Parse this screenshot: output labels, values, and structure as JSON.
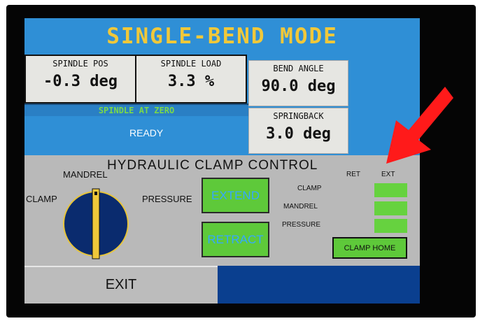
{
  "screen": {
    "title": "SINGLE-BEND MODE",
    "spindle_pos": {
      "label": "SPINDLE POS",
      "value": "-0.3 deg"
    },
    "spindle_load": {
      "label": "SPINDLE LOAD",
      "value": "3.3 %"
    },
    "bend_angle": {
      "label": "BEND ANGLE",
      "value": "90.0 deg"
    },
    "springback": {
      "label": "SPRINGBACK",
      "value": "3.0 deg"
    },
    "spindle_status": "SPINDLE AT ZERO",
    "status": "READY"
  },
  "clamp_panel": {
    "title": "HYDRAULIC CLAMP CONTROL",
    "dial_labels": {
      "mandrel": "MANDREL",
      "clamp": "CLAMP",
      "pressure": "PRESSURE"
    },
    "extend_label": "EXTEND",
    "retract_label": "RETRACT",
    "indicators": {
      "ret": "RET",
      "ext": "EXT",
      "rows": [
        "CLAMP",
        "MANDREL",
        "PRESSURE"
      ]
    },
    "clamp_home_label": "CLAMP HOME"
  },
  "footer": {
    "exit_label": "EXIT"
  },
  "colors": {
    "title": "#f0c83a",
    "screen_bg": "#2f8fd6",
    "panel_bg": "#b9b9b9",
    "button_green": "#5ec93a",
    "arrow": "#ff0000"
  }
}
